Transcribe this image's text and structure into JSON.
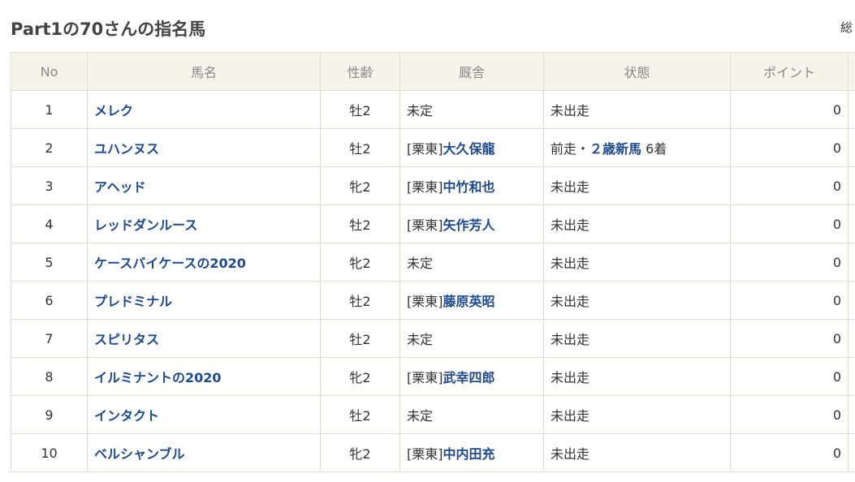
{
  "page": {
    "title": "Part1の70さんの指名馬",
    "total_label": "総"
  },
  "table": {
    "headers": [
      "No",
      "馬名",
      "性齢",
      "厩舎",
      "状態",
      "ポイント"
    ],
    "rows": [
      {
        "no": "1",
        "name": "メレク",
        "sex_age": "牡2",
        "stable_prefix": "未定",
        "stable_trainer": "",
        "status_prefix": "未出走",
        "status_link": "",
        "status_suffix": "",
        "points": "0"
      },
      {
        "no": "2",
        "name": "ユハンヌス",
        "sex_age": "牡2",
        "stable_prefix": "[栗東]",
        "stable_trainer": "大久保龍",
        "status_prefix": "前走・",
        "status_link": "２歳新馬",
        "status_suffix": " 6着",
        "points": "0"
      },
      {
        "no": "3",
        "name": "アヘッド",
        "sex_age": "牝2",
        "stable_prefix": "[栗東]",
        "stable_trainer": "中竹和也",
        "status_prefix": "未出走",
        "status_link": "",
        "status_suffix": "",
        "points": "0"
      },
      {
        "no": "4",
        "name": "レッドダンルース",
        "sex_age": "牡2",
        "stable_prefix": "[栗東]",
        "stable_trainer": "矢作芳人",
        "status_prefix": "未出走",
        "status_link": "",
        "status_suffix": "",
        "points": "0"
      },
      {
        "no": "5",
        "name": "ケースバイケースの2020",
        "sex_age": "牝2",
        "stable_prefix": "未定",
        "stable_trainer": "",
        "status_prefix": "未出走",
        "status_link": "",
        "status_suffix": "",
        "points": "0"
      },
      {
        "no": "6",
        "name": "プレドミナル",
        "sex_age": "牡2",
        "stable_prefix": "[栗東]",
        "stable_trainer": "藤原英昭",
        "status_prefix": "未出走",
        "status_link": "",
        "status_suffix": "",
        "points": "0"
      },
      {
        "no": "7",
        "name": "スピリタス",
        "sex_age": "牡2",
        "stable_prefix": "未定",
        "stable_trainer": "",
        "status_prefix": "未出走",
        "status_link": "",
        "status_suffix": "",
        "points": "0"
      },
      {
        "no": "8",
        "name": "イルミナントの2020",
        "sex_age": "牝2",
        "stable_prefix": "[栗東]",
        "stable_trainer": "武幸四郎",
        "status_prefix": "未出走",
        "status_link": "",
        "status_suffix": "",
        "points": "0"
      },
      {
        "no": "9",
        "name": "インタクト",
        "sex_age": "牡2",
        "stable_prefix": "未定",
        "stable_trainer": "",
        "status_prefix": "未出走",
        "status_link": "",
        "status_suffix": "",
        "points": "0"
      },
      {
        "no": "10",
        "name": "ベルシャンブル",
        "sex_age": "牝2",
        "stable_prefix": "[栗東]",
        "stable_trainer": "中内田充",
        "status_prefix": "未出走",
        "status_link": "",
        "status_suffix": "",
        "points": "0"
      }
    ]
  },
  "colors": {
    "header_bg": "#f6f3ea",
    "link": "#1f4a8c",
    "border": "#e0ddd3"
  }
}
